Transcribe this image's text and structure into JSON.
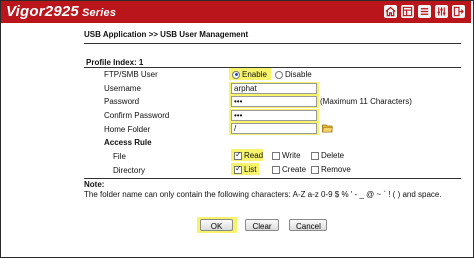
{
  "app": {
    "brand_name": "Vigor2925",
    "brand_series": "Series",
    "toolbar_icons": [
      "home-icon",
      "layout-icon",
      "list-icon",
      "sliders-icon",
      "logout-icon"
    ]
  },
  "breadcrumb": "USB Application >> USB User Management",
  "profile_index": "Profile Index: 1",
  "form": {
    "ftp_label": "FTP/SMB User",
    "enable_label": "Enable",
    "disable_label": "Disable",
    "enable_selected": true,
    "username_label": "Username",
    "username_value": "arphat",
    "password_label": "Password",
    "password_value": "•••",
    "password_hint": "(Maximum 11 Characters)",
    "confirm_label": "Confirm Password",
    "confirm_value": "•••",
    "home_label": "Home Folder",
    "home_value": "/",
    "access_rule_label": "Access Rule",
    "file_label": "File",
    "file_options": {
      "read": "Read",
      "write": "Write",
      "delete": "Delete"
    },
    "directory_label": "Directory",
    "dir_options": {
      "list": "List",
      "create": "Create",
      "remove": "Remove"
    }
  },
  "note": {
    "title": "Note:",
    "text": "The folder name can only contain the following characters: A-Z a-z 0-9 $ % ' - _ @ ~ ` ! ( ) and space."
  },
  "buttons": {
    "ok": "OK",
    "clear": "Clear",
    "cancel": "Cancel"
  },
  "colors": {
    "brand_red": "#b9151b",
    "highlight_yellow": "#f7f46b"
  }
}
